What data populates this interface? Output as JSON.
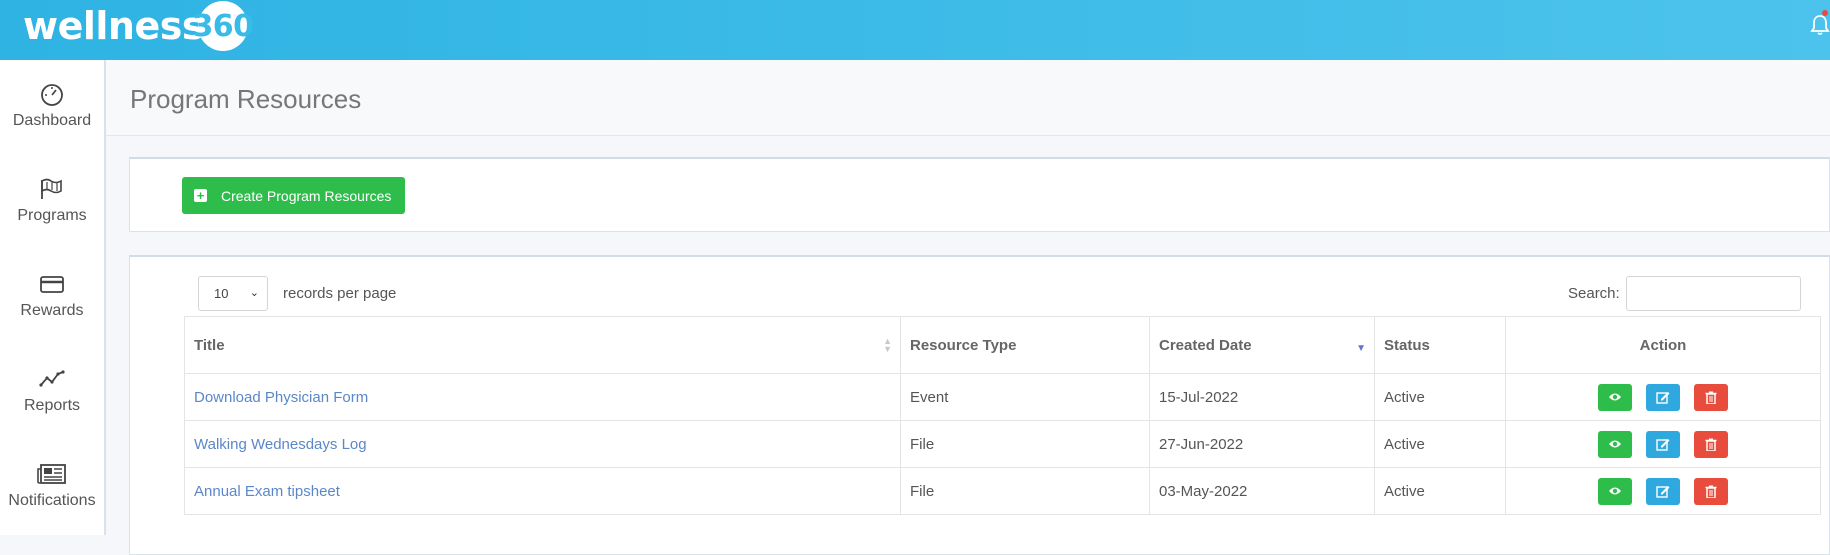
{
  "brand": {
    "word": "wellness",
    "badge": "360"
  },
  "sidebar": {
    "items": [
      {
        "label": "Dashboard",
        "icon": "speedometer-icon"
      },
      {
        "label": "Programs",
        "icon": "flag-icon"
      },
      {
        "label": "Rewards",
        "icon": "credit-card-icon"
      },
      {
        "label": "Reports",
        "icon": "line-chart-icon"
      },
      {
        "label": "Notifications",
        "icon": "newspaper-icon"
      }
    ]
  },
  "page": {
    "title": "Program Resources"
  },
  "toolbar": {
    "create_label": "Create Program Resources"
  },
  "table_controls": {
    "records_per_page_value": "10",
    "records_per_page_label": "records per page",
    "search_label": "Search:",
    "search_value": ""
  },
  "table": {
    "columns": [
      "Title",
      "Resource Type",
      "Created Date",
      "Status",
      "Action"
    ],
    "rows": [
      {
        "title": "Download Physician Form",
        "type": "Event",
        "date": "15-Jul-2022",
        "status": "Active"
      },
      {
        "title": "Walking Wednesdays Log",
        "type": "File",
        "date": "27-Jun-2022",
        "status": "Active"
      },
      {
        "title": "Annual Exam tipsheet",
        "type": "File",
        "date": "03-May-2022",
        "status": "Active"
      }
    ]
  },
  "colors": {
    "header_gradient_start": "#2eb3e3",
    "create_button": "#2ebd4b",
    "view_button": "#2ebd4b",
    "edit_button": "#2ea8de",
    "delete_button": "#e74c3c",
    "link": "#5b87c9"
  }
}
